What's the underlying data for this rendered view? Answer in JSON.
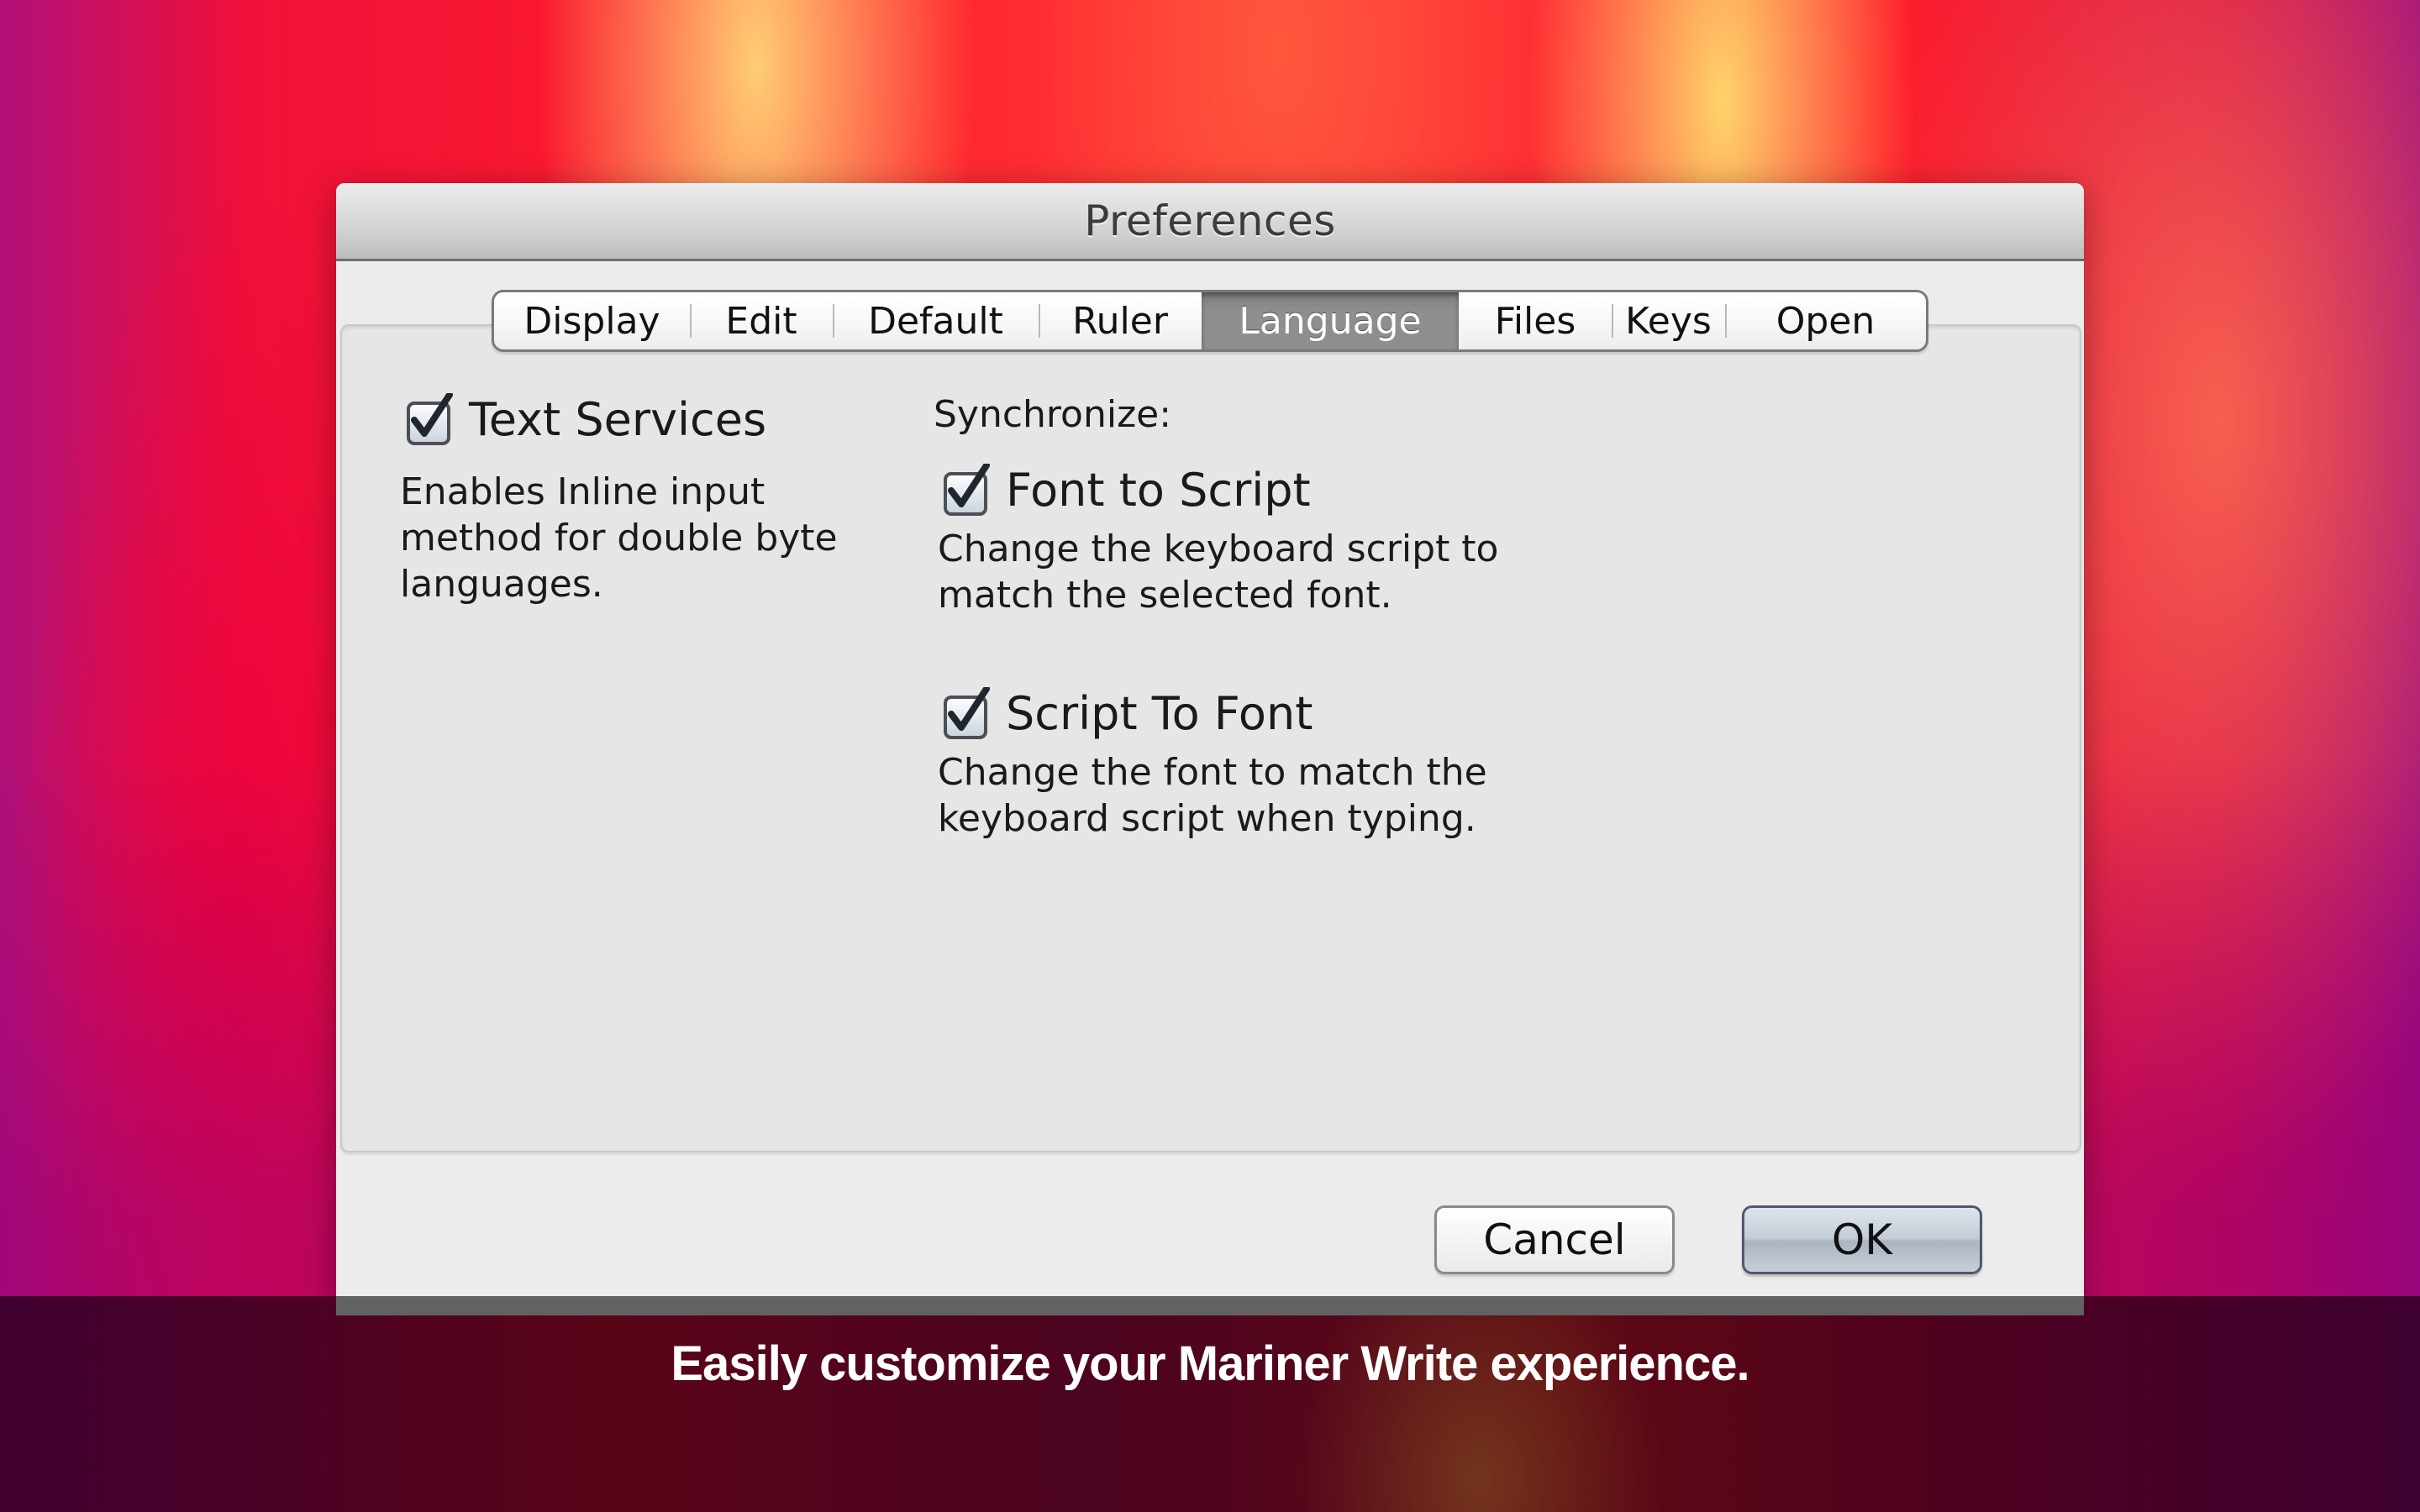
{
  "window": {
    "title": "Preferences"
  },
  "tabs": [
    {
      "label": "Display",
      "selected": false
    },
    {
      "label": "Edit",
      "selected": false
    },
    {
      "label": "Default",
      "selected": false
    },
    {
      "label": "Ruler",
      "selected": false
    },
    {
      "label": "Language",
      "selected": true
    },
    {
      "label": "Files",
      "selected": false
    },
    {
      "label": "Keys",
      "selected": false
    },
    {
      "label": "Open",
      "selected": false
    }
  ],
  "language_panel": {
    "text_services": {
      "label": "Text Services",
      "checked": true,
      "description": [
        "Enables Inline input",
        "method for double byte",
        "languages."
      ]
    },
    "synchronize_label": "Synchronize:",
    "font_to_script": {
      "label": "Font to Script",
      "checked": true,
      "description": [
        "Change the keyboard script to",
        "match the selected font."
      ]
    },
    "script_to_font": {
      "label": "Script To Font",
      "checked": true,
      "description": [
        "Change the font to match the",
        "keyboard script when typing."
      ]
    }
  },
  "buttons": {
    "cancel": "Cancel",
    "ok": "OK"
  },
  "caption": "Easily customize your Mariner Write experience.",
  "colors": {
    "selected_tab": "#8e8e8e",
    "ok_button": "#c3ccd6",
    "window_bg": "#ececec"
  }
}
